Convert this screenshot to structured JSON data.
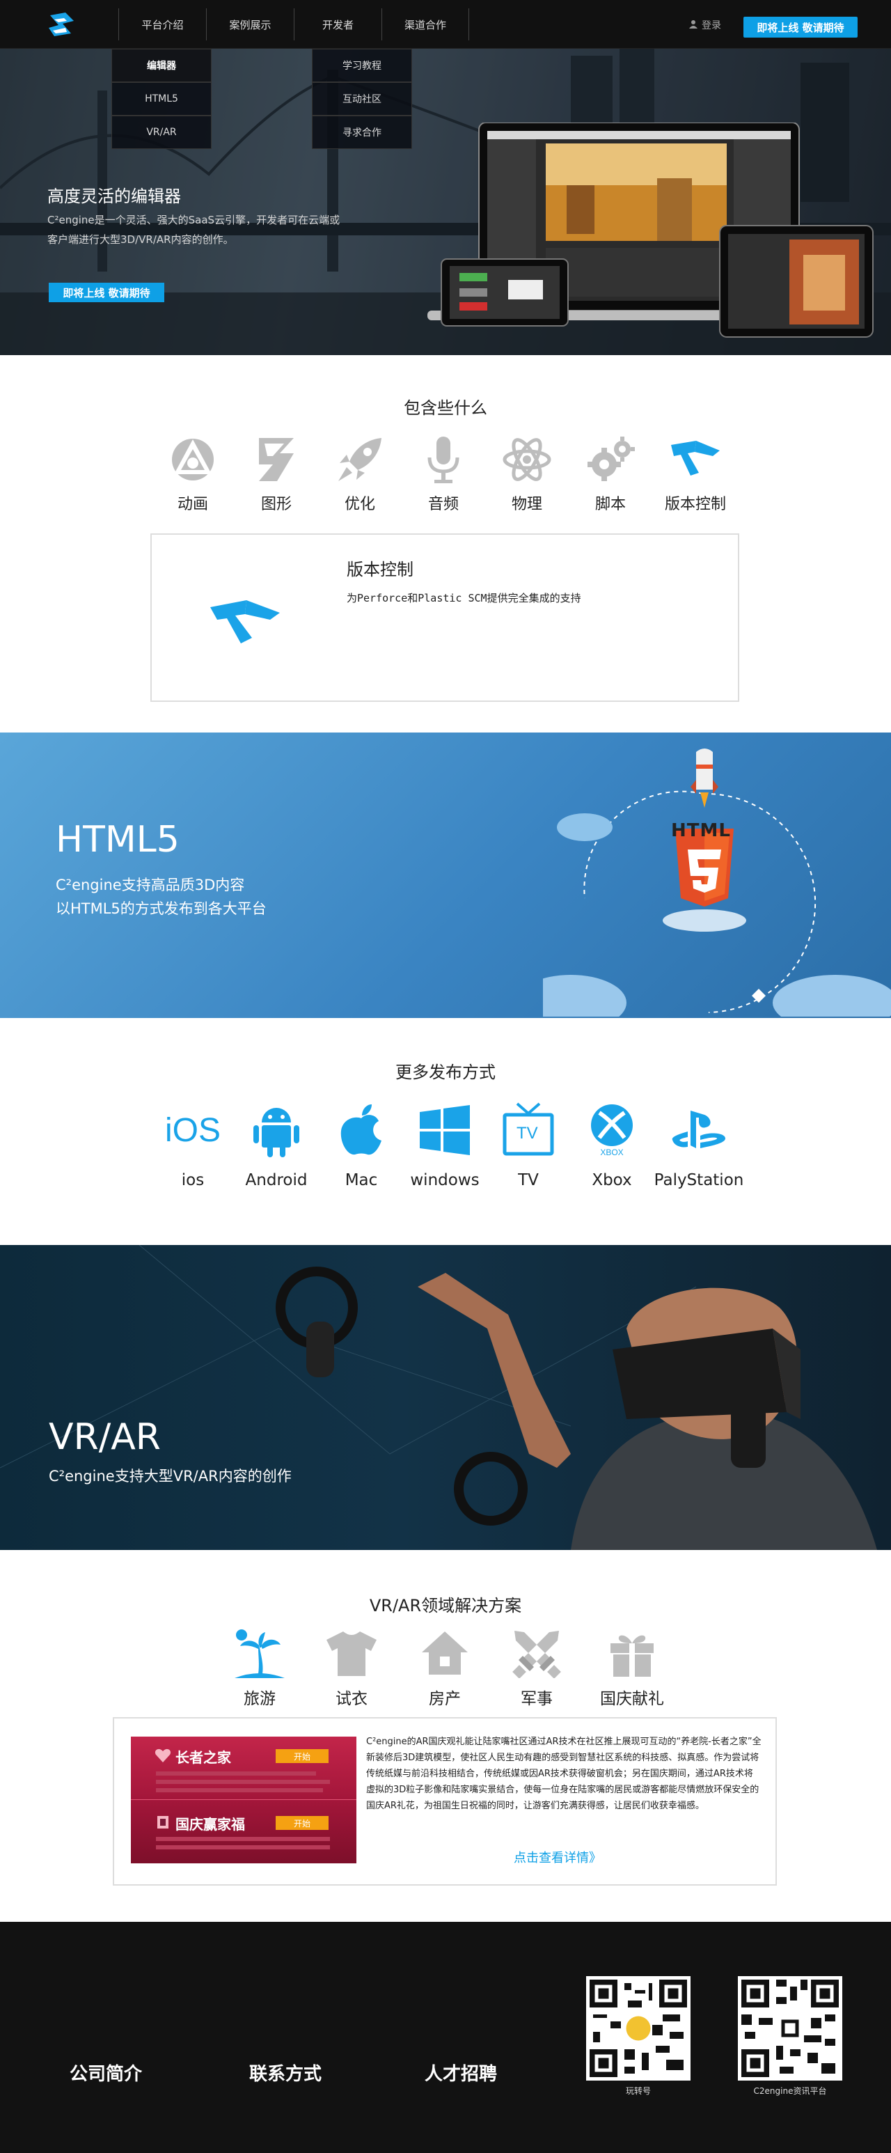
{
  "header": {
    "nav": [
      "平台介绍",
      "案例展示",
      "开发者",
      "渠道合作"
    ],
    "login": "登录",
    "cta": "即将上线 敬请期待",
    "submenu_left": [
      "编辑器",
      "HTML5",
      "VR/AR"
    ],
    "submenu_right": [
      "学习教程",
      "互动社区",
      "寻求合作"
    ]
  },
  "hero": {
    "title": "高度灵活的编辑器",
    "desc": "C²engine是一个灵活、强大的SaaS云引擎，开发者可在云端或客户端进行大型3D/VR/AR内容的创作。",
    "cta": "即将上线 敬请期待"
  },
  "features": {
    "title": "包含些什么",
    "items": [
      {
        "label": "动画",
        "icon": "animation-icon"
      },
      {
        "label": "图形",
        "icon": "graphics-icon"
      },
      {
        "label": "优化",
        "icon": "rocket-icon"
      },
      {
        "label": "音频",
        "icon": "microphone-icon"
      },
      {
        "label": "物理",
        "icon": "atom-icon"
      },
      {
        "label": "脚本",
        "icon": "gears-icon"
      },
      {
        "label": "版本控制",
        "icon": "version-control-icon"
      }
    ],
    "detail": {
      "title": "版本控制",
      "desc": "为Perforce和Plastic SCM提供完全集成的支持"
    }
  },
  "html5": {
    "title": "HTML5",
    "line1": "C²engine支持高品质3D内容",
    "line2": "以HTML5的方式发布到各大平台",
    "badge": "HTML"
  },
  "platforms": {
    "title": "更多发布方式",
    "items": [
      {
        "label": "ios",
        "icon": "ios-icon"
      },
      {
        "label": "Android",
        "icon": "android-icon"
      },
      {
        "label": "Mac",
        "icon": "apple-icon"
      },
      {
        "label": "windows",
        "icon": "windows-icon"
      },
      {
        "label": "TV",
        "icon": "tv-icon"
      },
      {
        "label": "Xbox",
        "icon": "xbox-icon"
      },
      {
        "label": "PalyStation",
        "icon": "playstation-icon"
      }
    ],
    "ios_glyph": "iOS",
    "tv_glyph": "TV",
    "xbox_glyph": "XBOX"
  },
  "vr": {
    "title": "VR/AR",
    "desc": "C²engine支持大型VR/AR内容的创作"
  },
  "solutions": {
    "title": "VR/AR领域解决方案",
    "items": [
      {
        "label": "旅游",
        "icon": "palm-tree-icon"
      },
      {
        "label": "试衣",
        "icon": "tshirt-icon"
      },
      {
        "label": "房产",
        "icon": "house-icon"
      },
      {
        "label": "军事",
        "icon": "swords-icon"
      },
      {
        "label": "国庆献礼",
        "icon": "gift-icon"
      }
    ],
    "ad": {
      "title1": "长者之家",
      "title2": "国庆赢家福",
      "btn": "开始"
    },
    "text": "C²engine的AR国庆观礼能让陆家嘴社区通过AR技术在社区推上展现可互动的“养老院-长者之家”全新装修后3D建筑模型，使社区人民生动有趣的感受到智慧社区系统的科技感、拟真感。作为尝试将传统纸媒与前沿科技相结合，传统纸媒或因AR技术获得破窗机会；另在国庆期间，通过AR技术将虚拟的3D粒子影像和陆家嘴实景结合，使每一位身在陆家嘴的居民或游客都能尽情燃放环保安全的国庆AR礼花，为祖国生日祝福的同时，让游客们充满获得感，让居民们收获幸福感。",
    "more": "点击查看详情》"
  },
  "footer": {
    "links": [
      "公司简介",
      "联系方式",
      "人才招聘"
    ],
    "qr1": "玩转号",
    "qr2": "C2engine资讯平台"
  }
}
